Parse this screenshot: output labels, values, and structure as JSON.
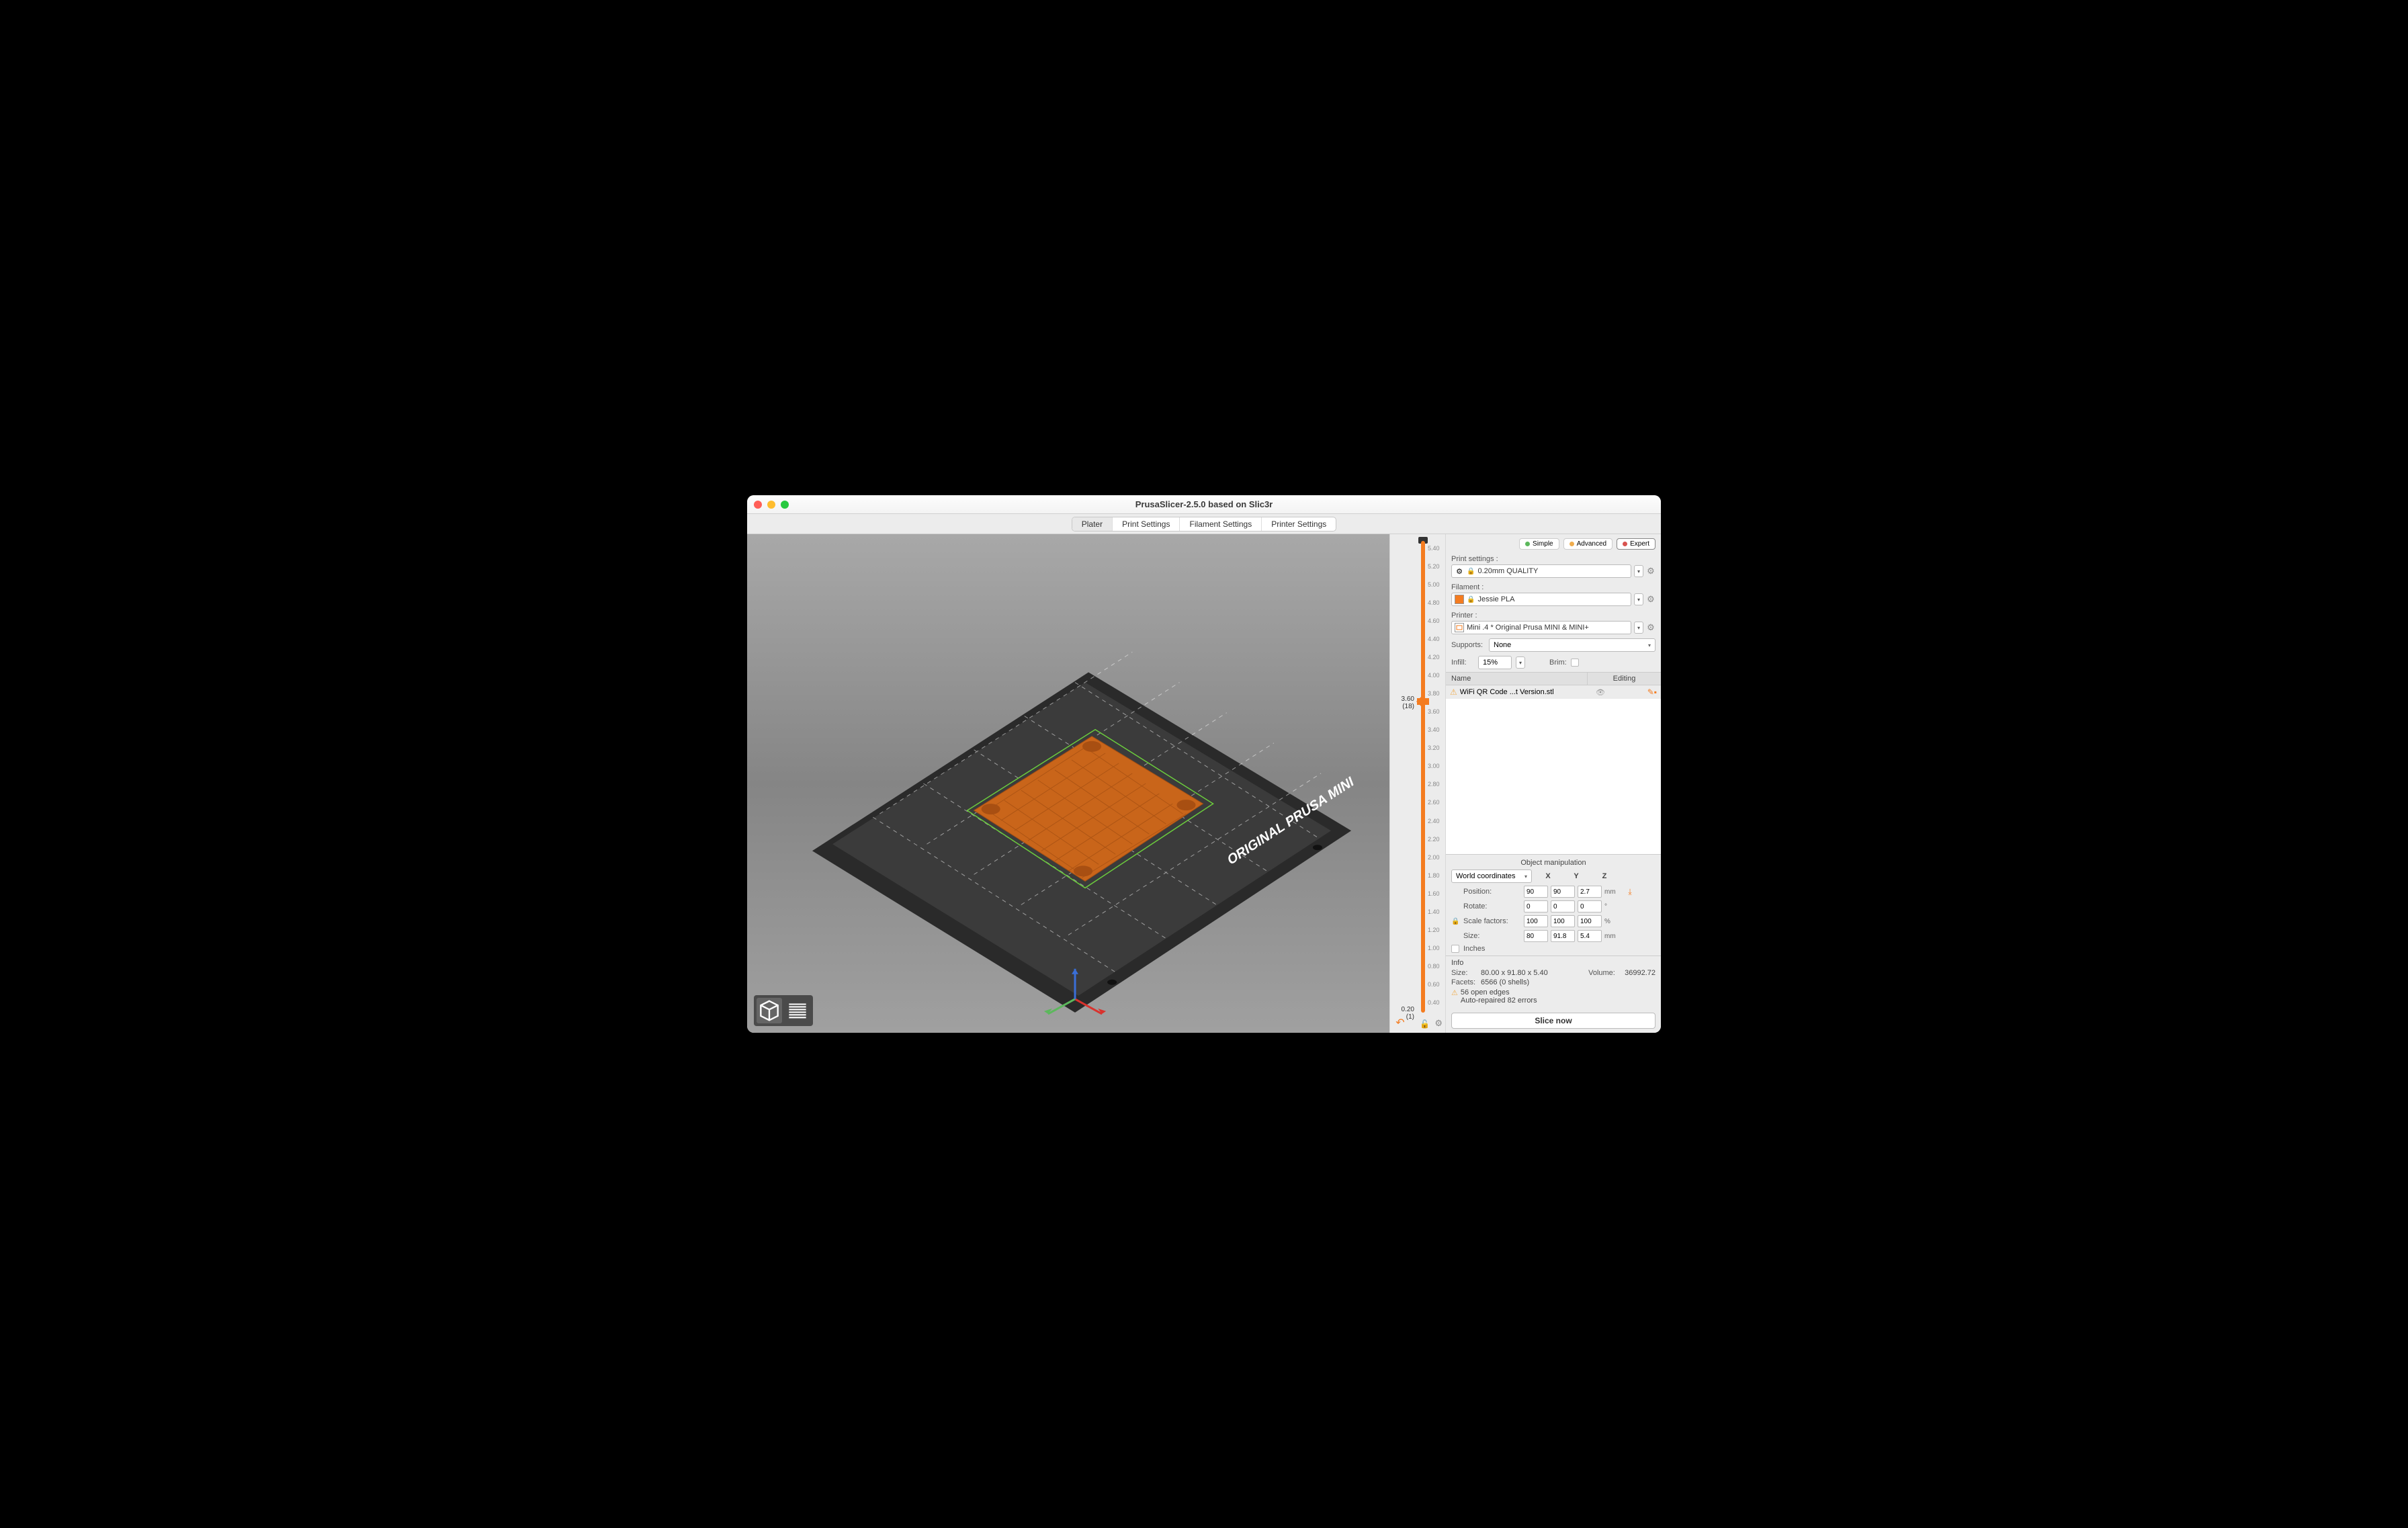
{
  "window": {
    "title": "PrusaSlicer-2.5.0 based on Slic3r"
  },
  "tabs": [
    "Plater",
    "Print Settings",
    "Filament Settings",
    "Printer Settings"
  ],
  "active_tab": 0,
  "modes": {
    "simple": "Simple",
    "advanced": "Advanced",
    "expert": "Expert"
  },
  "labels": {
    "print_settings": "Print settings :",
    "filament": "Filament :",
    "printer": "Printer :",
    "supports": "Supports:",
    "infill": "Infill:",
    "brim": "Brim:",
    "name": "Name",
    "editing": "Editing",
    "object_manipulation": "Object manipulation",
    "world_coords": "World coordinates",
    "position": "Position:",
    "rotate": "Rotate:",
    "scale_factors": "Scale factors:",
    "size": "Size:",
    "inches": "Inches",
    "info": "Info",
    "info_size": "Size:",
    "info_volume": "Volume:",
    "info_facets": "Facets:",
    "slice": "Slice now",
    "x": "X",
    "y": "Y",
    "z": "Z",
    "mm": "mm",
    "deg": "°",
    "pct": "%"
  },
  "print_setting": "0.20mm QUALITY",
  "filament": "Jessie PLA",
  "printer": "Mini .4 * Original Prusa MINI & MINI+",
  "supports": "None",
  "infill": "15%",
  "brim_checked": false,
  "objects": [
    {
      "name": "WiFi QR Code ...t Version.stl",
      "warn": true
    }
  ],
  "manipulation": {
    "position": {
      "x": "90",
      "y": "90",
      "z": "2.7"
    },
    "rotate": {
      "x": "0",
      "y": "0",
      "z": "0"
    },
    "scale": {
      "x": "100",
      "y": "100",
      "z": "100"
    },
    "size": {
      "x": "80",
      "y": "91.8",
      "z": "5.4"
    },
    "inches_checked": false
  },
  "info": {
    "size": "80.00 x 91.80 x 5.40",
    "volume": "36992.72",
    "facets": "6566 (0 shells)",
    "warn1": "56 open edges",
    "warn2": "Auto-repaired 82 errors"
  },
  "slider": {
    "top_cap": "",
    "current": "3.60",
    "current_layer": "(18)",
    "bottom": "0.20",
    "bottom_layer": "(1)",
    "ticks": [
      "5.40",
      "5.20",
      "5.00",
      "4.80",
      "4.60",
      "4.40",
      "4.20",
      "4.00",
      "3.80",
      "3.60",
      "3.40",
      "3.20",
      "3.00",
      "2.80",
      "2.60",
      "2.40",
      "2.20",
      "2.00",
      "1.80",
      "1.60",
      "1.40",
      "1.20",
      "1.00",
      "0.80",
      "0.60",
      "0.40"
    ]
  },
  "bed_label": "ORIGINAL PRUSA MINI"
}
